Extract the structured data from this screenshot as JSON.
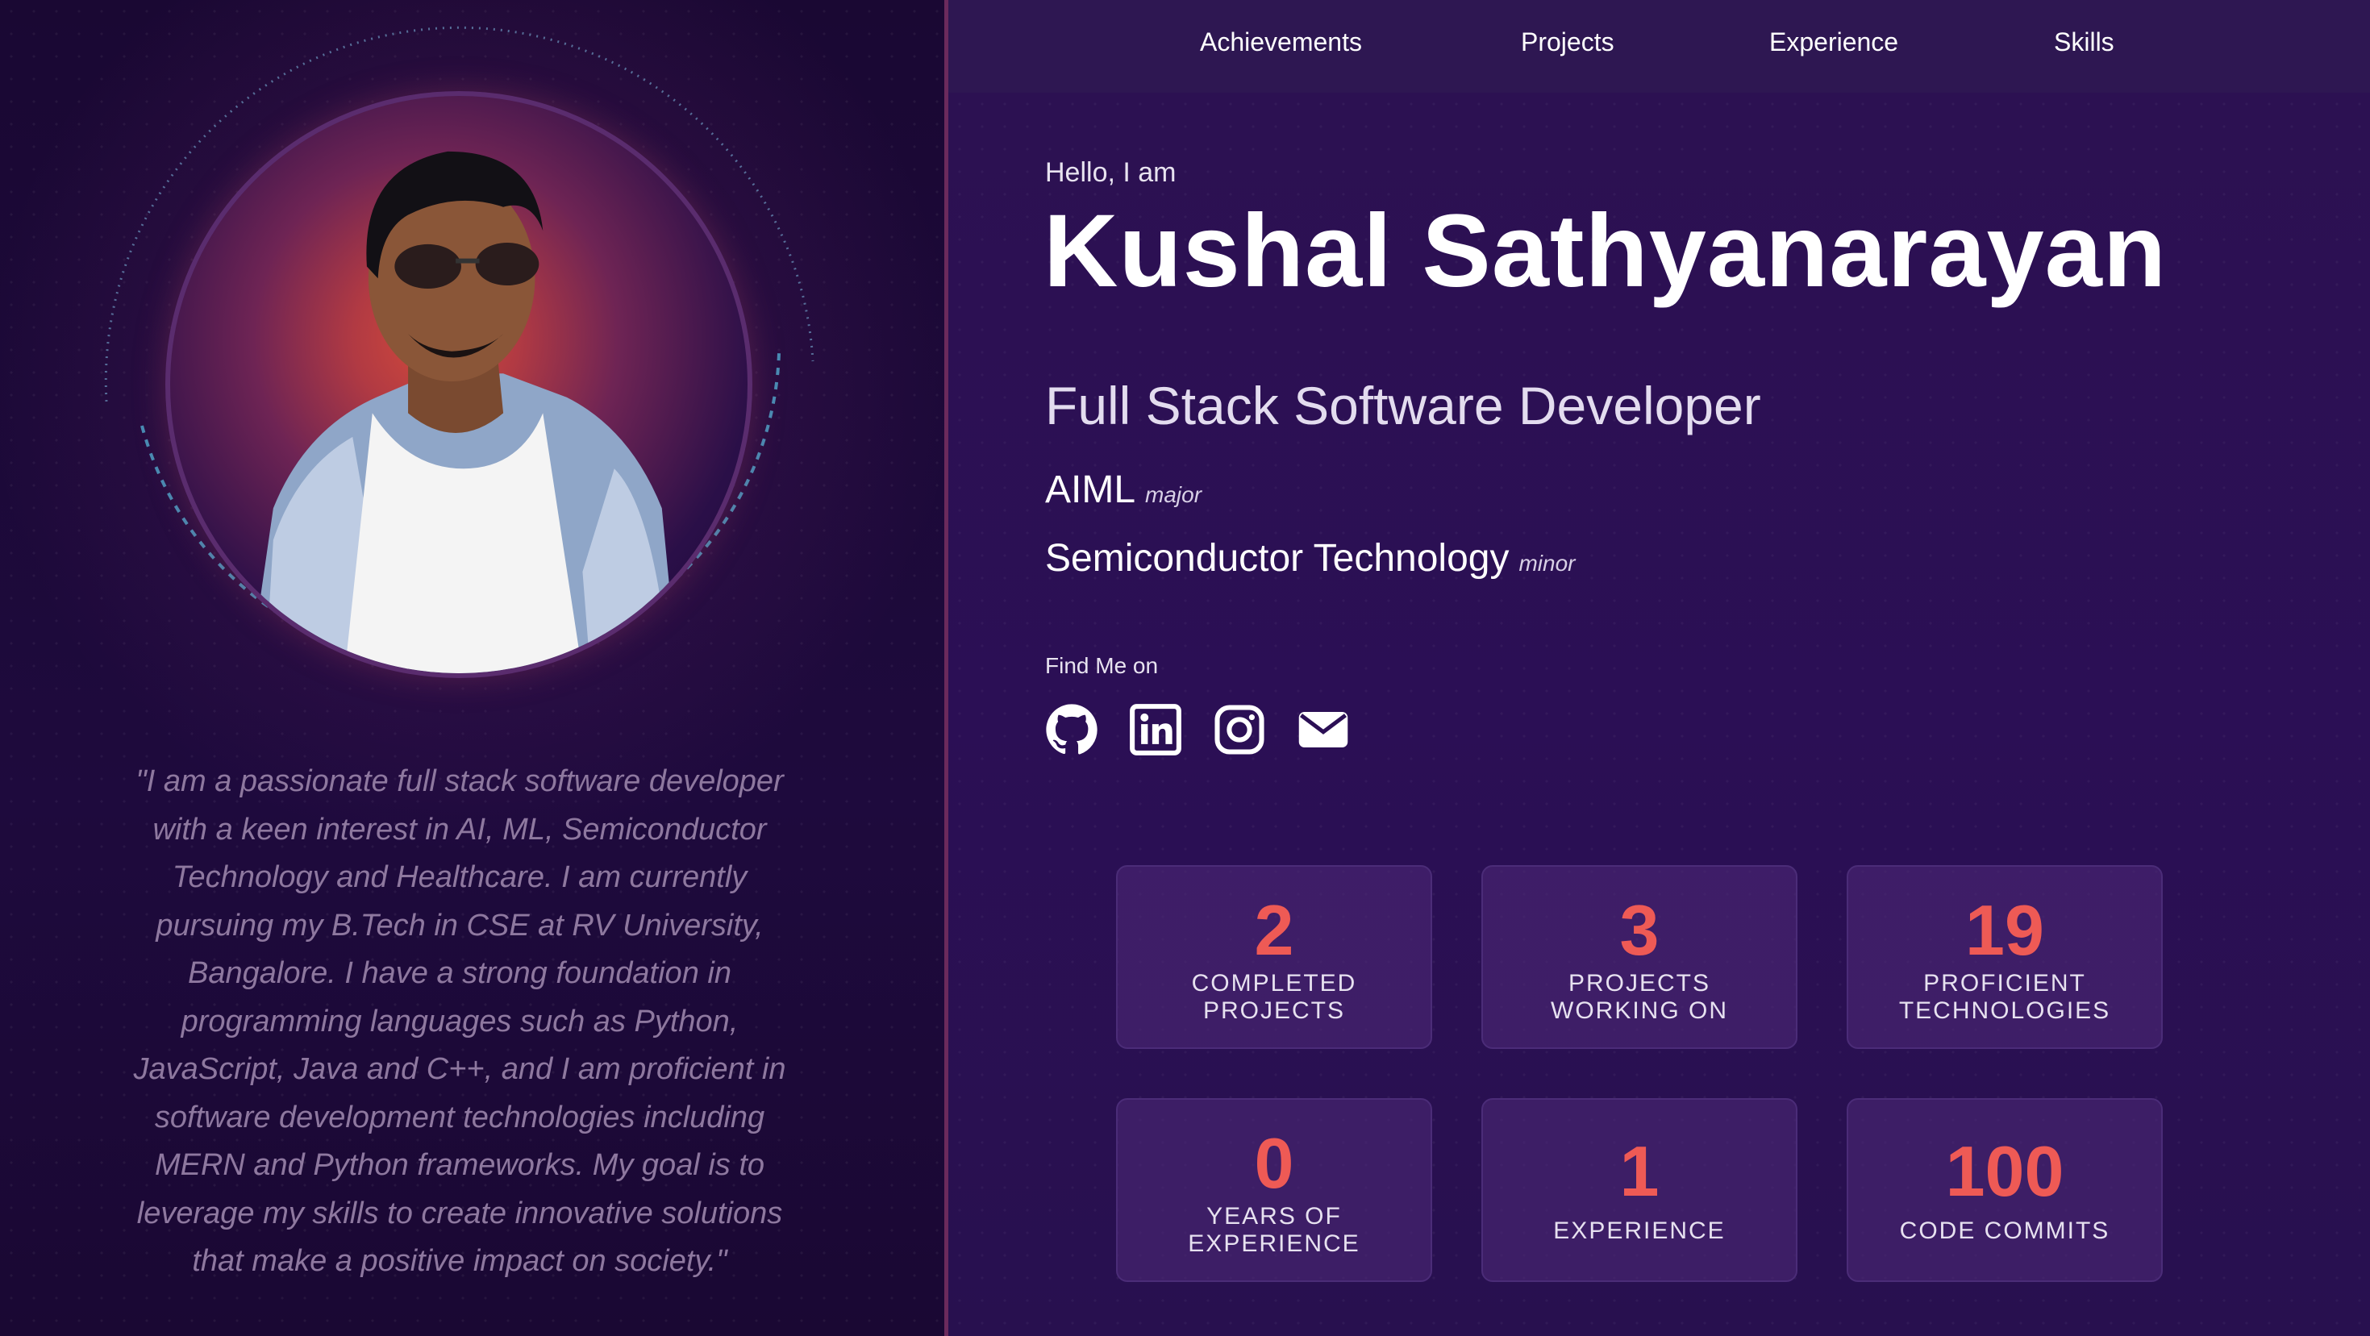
{
  "nav": {
    "items": [
      {
        "label": "Achievements"
      },
      {
        "label": "Projects"
      },
      {
        "label": "Experience"
      },
      {
        "label": "Skills"
      }
    ]
  },
  "profile": {
    "bio": "\"I am a passionate full stack software developer with a keen interest in AI, ML, Semiconductor Technology and Healthcare. I am currently pursuing my B.Tech in CSE at RV University, Bangalore. I have a strong foundation in programming languages such as Python, JavaScript, Java and C++, and I am proficient in software development technologies including MERN and Python frameworks. My goal is to leverage my skills to create innovative solutions that make a positive impact on society.\"",
    "bio_lines": [
      "\"I am a passionate full stack software developer",
      "with a keen interest in AI, ML, Semiconductor",
      "Technology and Healthcare. I am currently",
      "pursuing my B.Tech in CSE at RV University,",
      "Bangalore. I have a strong foundation in",
      "programming languages such as Python,",
      "JavaScript, Java and C++, and I am proficient in",
      "software development technologies including",
      "MERN and Python frameworks. My goal is to",
      "leverage my skills to create innovative solutions",
      "that make a positive impact on society.\""
    ]
  },
  "hero": {
    "greeting": "Hello, I am",
    "name": "Kushal Sathyanarayan",
    "role": "Full Stack Software Developer",
    "major": {
      "value": "AIML",
      "tag": "major"
    },
    "minor": {
      "value": "Semiconductor Technology",
      "tag": "minor"
    },
    "find_me": "Find Me on",
    "socials": [
      {
        "icon": "github-icon"
      },
      {
        "icon": "linkedin-icon"
      },
      {
        "icon": "instagram-icon"
      },
      {
        "icon": "email-icon"
      }
    ]
  },
  "stats": [
    {
      "number": "2",
      "label_lines": [
        "COMPLETED",
        "PROJECTS"
      ]
    },
    {
      "number": "3",
      "label_lines": [
        "PROJECTS",
        "WORKING ON"
      ]
    },
    {
      "number": "19",
      "label_lines": [
        "PROFICIENT",
        "TECHNOLOGIES"
      ]
    },
    {
      "number": "0",
      "label_lines": [
        "YEARS OF",
        "EXPERIENCE"
      ]
    },
    {
      "number": "1",
      "label_lines": [
        "EXPERIENCE"
      ]
    },
    {
      "number": "100",
      "label_lines": [
        "CODE COMMITS"
      ]
    }
  ],
  "colors": {
    "accent": "#ee5a55",
    "background": "#2b0f55",
    "nav": "#2e1752"
  }
}
